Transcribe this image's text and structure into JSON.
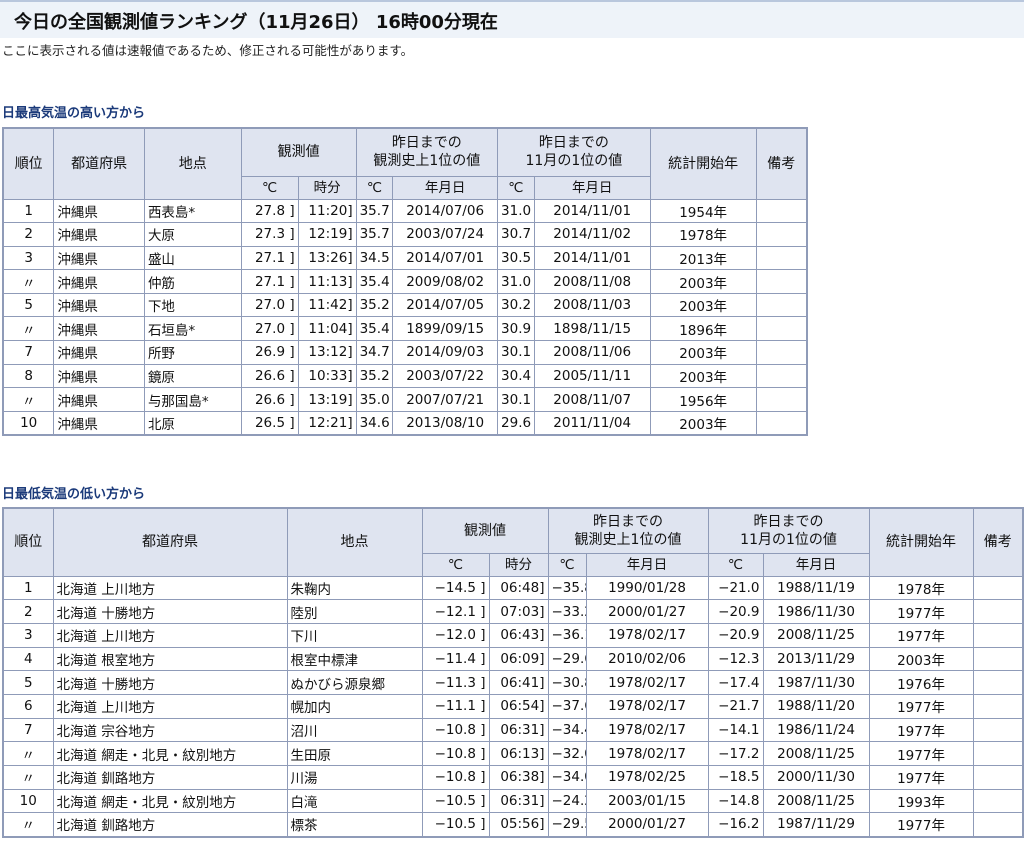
{
  "page": {
    "title": "今日の全国観測値ランキング（11月26日） 16時00分現在",
    "note": "ここに表示される値は速報値であるため、修正される可能性があります。"
  },
  "headers": {
    "rank": "順位",
    "pref": "都道府県",
    "point": "地点",
    "obs": "観測値",
    "rec_line1": "昨日までの",
    "rec_line2": "観測史上1位の値",
    "mon_line1": "昨日までの",
    "mon_line2": "11月の1位の値",
    "start": "統計開始年",
    "remark": "備考",
    "deg": "℃",
    "time": "時分",
    "date": "年月日"
  },
  "high": {
    "heading": "日最高気温の高い方から",
    "rows": [
      {
        "rank": "1",
        "pref": "沖縄県",
        "point": "西表島*",
        "val": "27.8 ]",
        "time": "11:20]",
        "rec": "35.7",
        "rec_date": "2014/07/06",
        "mon": "31.0",
        "mon_date": "2014/11/01",
        "start": "1954年",
        "remark": ""
      },
      {
        "rank": "2",
        "pref": "沖縄県",
        "point": "大原",
        "val": "27.3 ]",
        "time": "12:19]",
        "rec": "35.7",
        "rec_date": "2003/07/24",
        "mon": "30.7",
        "mon_date": "2014/11/02",
        "start": "1978年",
        "remark": ""
      },
      {
        "rank": "3",
        "pref": "沖縄県",
        "point": "盛山",
        "val": "27.1 ]",
        "time": "13:26]",
        "rec": "34.5",
        "rec_date": "2014/07/01",
        "mon": "30.5",
        "mon_date": "2014/11/01",
        "start": "2013年",
        "remark": ""
      },
      {
        "rank": "〃",
        "pref": "沖縄県",
        "point": "仲筋",
        "val": "27.1 ]",
        "time": "11:13]",
        "rec": "35.4",
        "rec_date": "2009/08/02",
        "mon": "31.0",
        "mon_date": "2008/11/08",
        "start": "2003年",
        "remark": ""
      },
      {
        "rank": "5",
        "pref": "沖縄県",
        "point": "下地",
        "val": "27.0 ]",
        "time": "11:42]",
        "rec": "35.2",
        "rec_date": "2014/07/05",
        "mon": "30.2",
        "mon_date": "2008/11/03",
        "start": "2003年",
        "remark": ""
      },
      {
        "rank": "〃",
        "pref": "沖縄県",
        "point": "石垣島*",
        "val": "27.0 ]",
        "time": "11:04]",
        "rec": "35.4",
        "rec_date": "1899/09/15",
        "mon": "30.9",
        "mon_date": "1898/11/15",
        "start": "1896年",
        "remark": ""
      },
      {
        "rank": "7",
        "pref": "沖縄県",
        "point": "所野",
        "val": "26.9 ]",
        "time": "13:12]",
        "rec": "34.7",
        "rec_date": "2014/09/03",
        "mon": "30.1",
        "mon_date": "2008/11/06",
        "start": "2003年",
        "remark": ""
      },
      {
        "rank": "8",
        "pref": "沖縄県",
        "point": "鏡原",
        "val": "26.6 ]",
        "time": "10:33]",
        "rec": "35.2",
        "rec_date": "2003/07/22",
        "mon": "30.4",
        "mon_date": "2005/11/11",
        "start": "2003年",
        "remark": ""
      },
      {
        "rank": "〃",
        "pref": "沖縄県",
        "point": "与那国島*",
        "val": "26.6 ]",
        "time": "13:19]",
        "rec": "35.0",
        "rec_date": "2007/07/21",
        "mon": "30.1",
        "mon_date": "2008/11/07",
        "start": "1956年",
        "remark": ""
      },
      {
        "rank": "10",
        "pref": "沖縄県",
        "point": "北原",
        "val": "26.5 ]",
        "time": "12:21]",
        "rec": "34.6",
        "rec_date": "2013/08/10",
        "mon": "29.6",
        "mon_date": "2011/11/04",
        "start": "2003年",
        "remark": ""
      }
    ]
  },
  "low": {
    "heading": "日最低気温の低い方から",
    "rows": [
      {
        "rank": "1",
        "pref": "北海道 上川地方",
        "point": "朱鞠内",
        "val": "−14.5 ]",
        "time": "06:48]",
        "rec": "−35.8",
        "rec_date": "1990/01/28",
        "mon": "−21.0",
        "mon_date": "1988/11/19",
        "start": "1978年",
        "remark": ""
      },
      {
        "rank": "2",
        "pref": "北海道 十勝地方",
        "point": "陸別",
        "val": "−12.1 ]",
        "time": "07:03]",
        "rec": "−33.2",
        "rec_date": "2000/01/27",
        "mon": "−20.9",
        "mon_date": "1986/11/30",
        "start": "1977年",
        "remark": ""
      },
      {
        "rank": "3",
        "pref": "北海道 上川地方",
        "point": "下川",
        "val": "−12.0 ]",
        "time": "06:43]",
        "rec": "−36.1",
        "rec_date": "1978/02/17",
        "mon": "−20.9",
        "mon_date": "2008/11/25",
        "start": "1977年",
        "remark": ""
      },
      {
        "rank": "4",
        "pref": "北海道 根室地方",
        "point": "根室中標津",
        "val": "−11.4 ]",
        "time": "06:09]",
        "rec": "−29.6",
        "rec_date": "2010/02/06",
        "mon": "−12.3",
        "mon_date": "2013/11/29",
        "start": "2003年",
        "remark": ""
      },
      {
        "rank": "5",
        "pref": "北海道 十勝地方",
        "point": "ぬかびら源泉郷",
        "val": "−11.3 ]",
        "time": "06:41]",
        "rec": "−30.8",
        "rec_date": "1978/02/17",
        "mon": "−17.4",
        "mon_date": "1987/11/30",
        "start": "1976年",
        "remark": ""
      },
      {
        "rank": "6",
        "pref": "北海道 上川地方",
        "point": "幌加内",
        "val": "−11.1 ]",
        "time": "06:54]",
        "rec": "−37.6",
        "rec_date": "1978/02/17",
        "mon": "−21.7",
        "mon_date": "1988/11/20",
        "start": "1977年",
        "remark": ""
      },
      {
        "rank": "7",
        "pref": "北海道 宗谷地方",
        "point": "沼川",
        "val": "−10.8 ]",
        "time": "06:31]",
        "rec": "−34.4",
        "rec_date": "1978/02/17",
        "mon": "−14.1",
        "mon_date": "1986/11/24",
        "start": "1977年",
        "remark": ""
      },
      {
        "rank": "〃",
        "pref": "北海道 網走・北見・紋別地方",
        "point": "生田原",
        "val": "−10.8 ]",
        "time": "06:13]",
        "rec": "−32.0",
        "rec_date": "1978/02/17",
        "mon": "−17.2",
        "mon_date": "2008/11/25",
        "start": "1977年",
        "remark": ""
      },
      {
        "rank": "〃",
        "pref": "北海道 釧路地方",
        "point": "川湯",
        "val": "−10.8 ]",
        "time": "06:38]",
        "rec": "−34.0",
        "rec_date": "1978/02/25",
        "mon": "−18.5",
        "mon_date": "2000/11/30",
        "start": "1977年",
        "remark": ""
      },
      {
        "rank": "10",
        "pref": "北海道 網走・北見・紋別地方",
        "point": "白滝",
        "val": "−10.5 ]",
        "time": "06:31]",
        "rec": "−24.2",
        "rec_date": "2003/01/15",
        "mon": "−14.8",
        "mon_date": "2008/11/25",
        "start": "1993年",
        "remark": ""
      },
      {
        "rank": "〃",
        "pref": "北海道 釧路地方",
        "point": "標茶",
        "val": "−10.5 ]",
        "time": "05:56]",
        "rec": "−29.5",
        "rec_date": "2000/01/27",
        "mon": "−16.2",
        "mon_date": "1987/11/29",
        "start": "1977年",
        "remark": ""
      }
    ]
  }
}
